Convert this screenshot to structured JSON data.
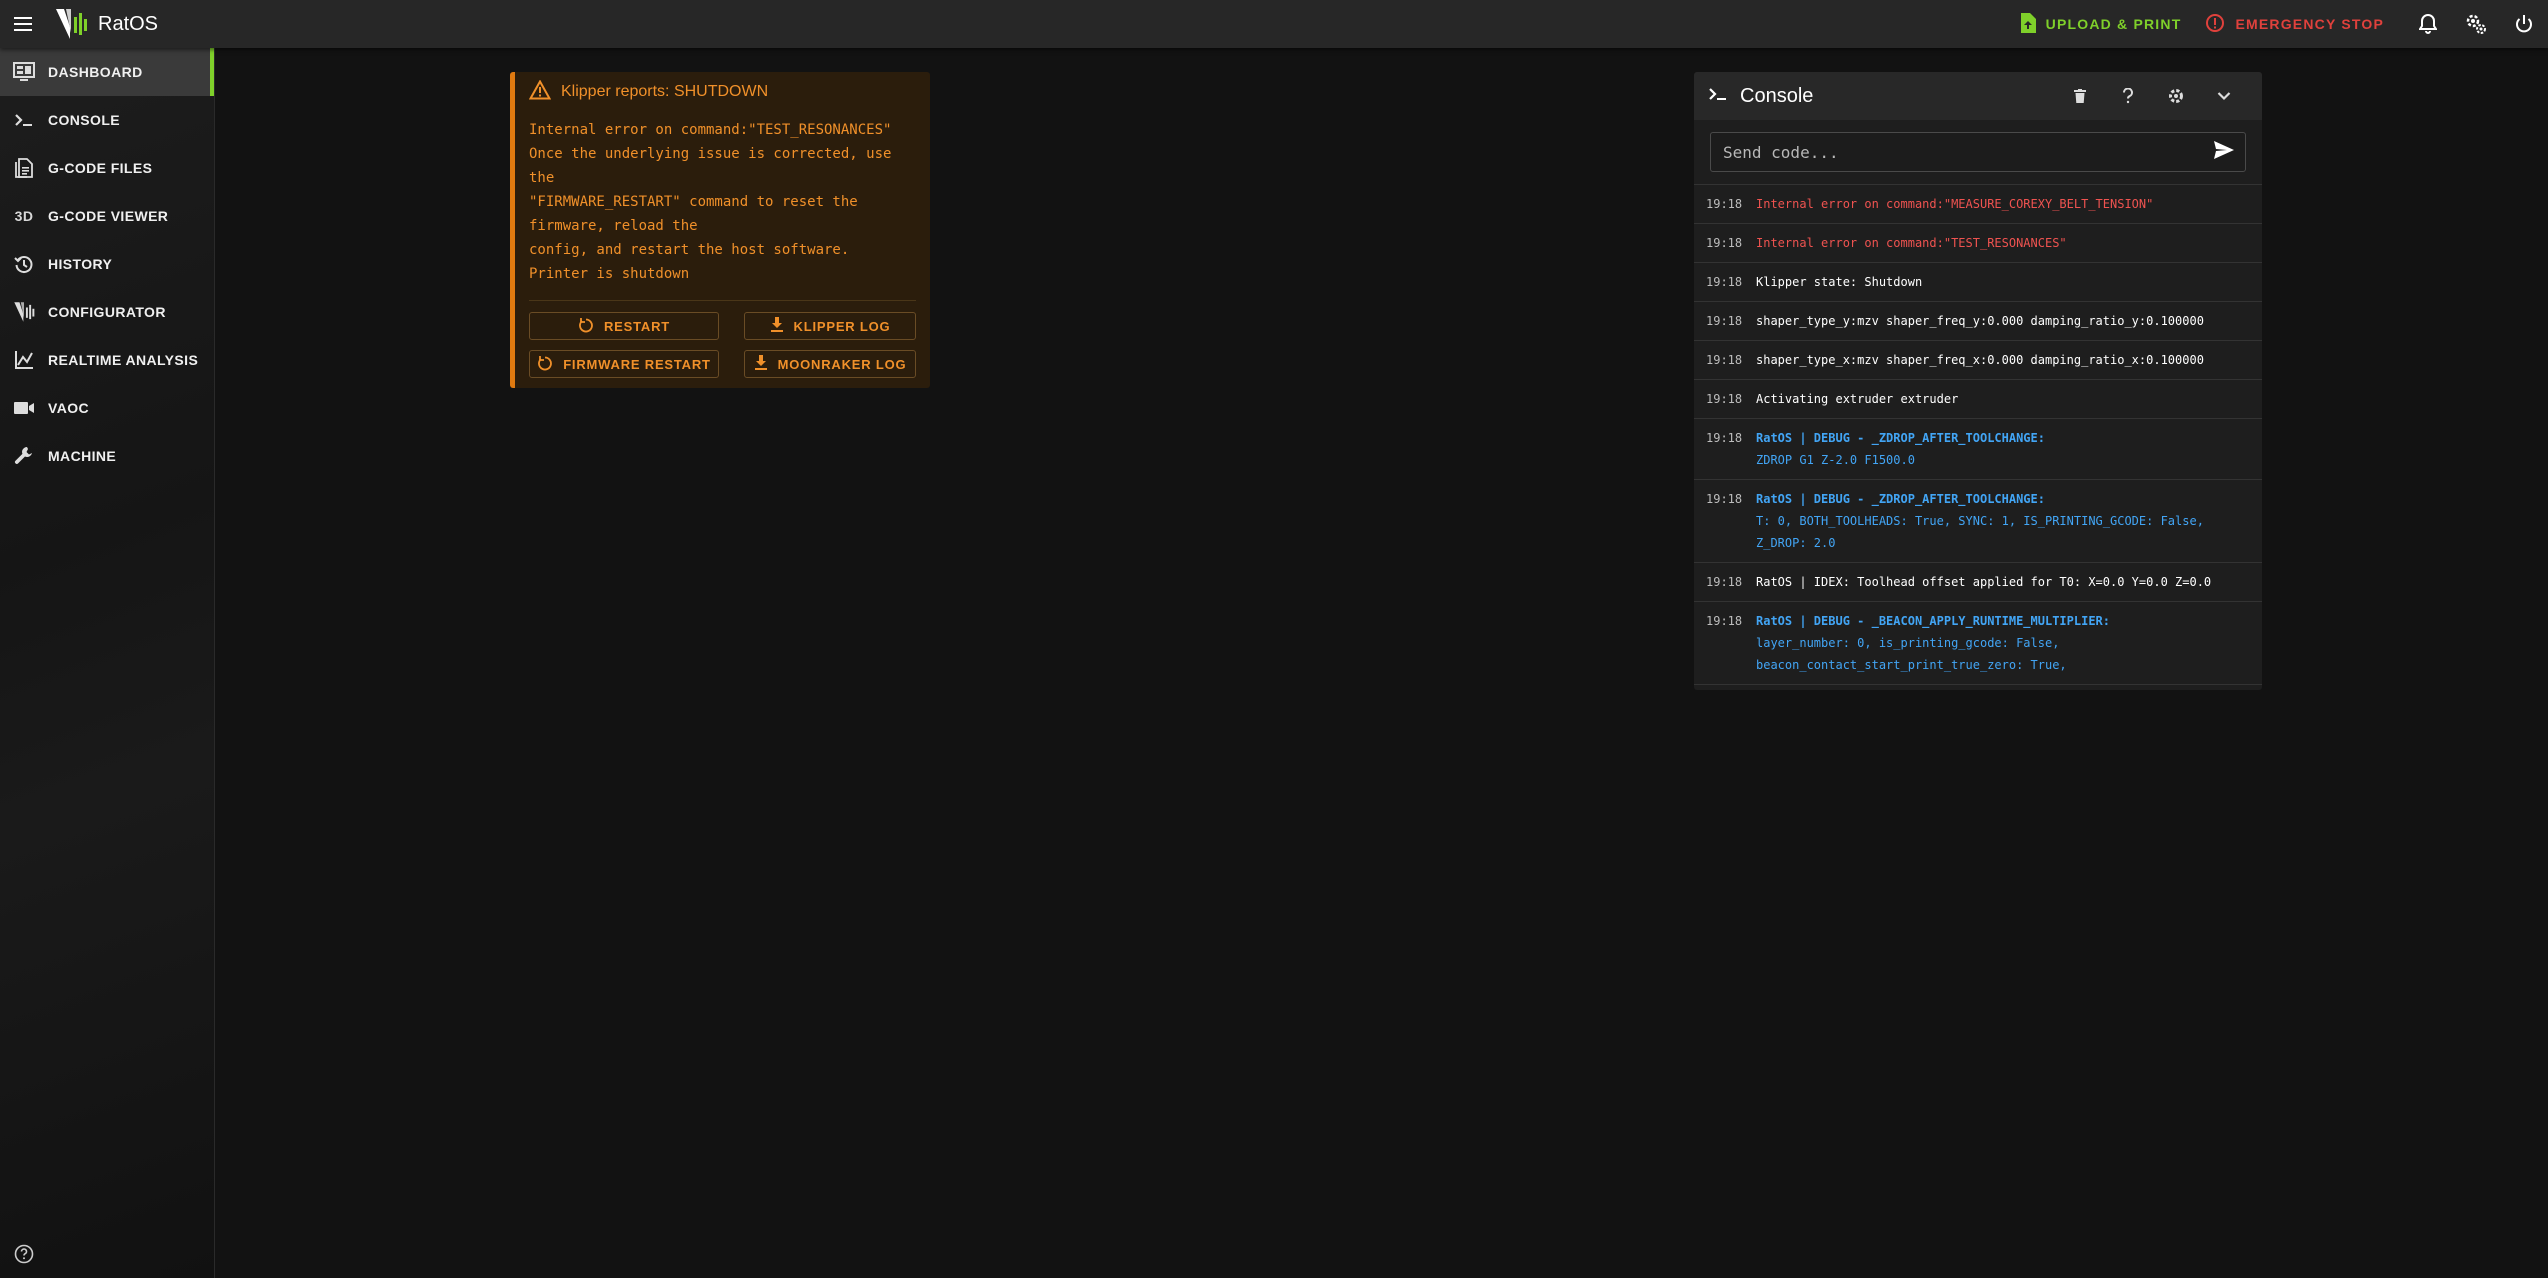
{
  "app": {
    "title": "RatOS",
    "upload_label": "UPLOAD & PRINT",
    "estop_label": "EMERGENCY STOP",
    "colors": {
      "accent": "#7fd02a",
      "danger": "#e0413c",
      "warning": "#f0902a"
    }
  },
  "sidebar": {
    "items": [
      {
        "label": "DASHBOARD",
        "icon": "monitor-dashboard-icon"
      },
      {
        "label": "CONSOLE",
        "icon": "console-prompt-icon"
      },
      {
        "label": "G-CODE FILES",
        "icon": "file-document-icon"
      },
      {
        "label": "G-CODE VIEWER",
        "icon": "3d-icon",
        "glyph": "3D"
      },
      {
        "label": "HISTORY",
        "icon": "history-icon"
      },
      {
        "label": "CONFIGURATOR",
        "icon": "ratos-logo-icon"
      },
      {
        "label": "REALTIME ANALYSIS",
        "icon": "chart-line-icon"
      },
      {
        "label": "VAOC",
        "icon": "video-camera-icon"
      },
      {
        "label": "MACHINE",
        "icon": "wrench-icon"
      }
    ]
  },
  "shutdown": {
    "title": "Klipper reports: SHUTDOWN",
    "message": "Internal error on command:\"TEST_RESONANCES\"\nOnce the underlying issue is corrected, use\nthe\n\"FIRMWARE_RESTART\" command to reset the\nfirmware, reload the\nconfig, and restart the host software.\nPrinter is shutdown",
    "buttons": {
      "restart": "RESTART",
      "klipper_log": "KLIPPER LOG",
      "firmware_restart": "FIRMWARE RESTART",
      "moonraker_log": "MOONRAKER LOG"
    }
  },
  "console": {
    "title": "Console",
    "placeholder": "Send code...",
    "entries": [
      {
        "time": "19:18",
        "type": "error",
        "text": "Internal error on command:\"MEASURE_COREXY_BELT_TENSION\""
      },
      {
        "time": "19:18",
        "type": "error",
        "text": "Internal error on command:\"TEST_RESONANCES\""
      },
      {
        "time": "19:18",
        "type": "normal",
        "text": "Klipper state: Shutdown"
      },
      {
        "time": "19:18",
        "type": "normal",
        "text": "shaper_type_y:mzv shaper_freq_y:0.000 damping_ratio_y:0.100000"
      },
      {
        "time": "19:18",
        "type": "normal",
        "text": "shaper_type_x:mzv shaper_freq_x:0.000 damping_ratio_x:0.100000"
      },
      {
        "time": "19:18",
        "type": "normal",
        "text": "Activating extruder extruder"
      },
      {
        "time": "19:18",
        "type": "info",
        "head": "RatOS | DEBUG - _ZDROP_AFTER_TOOLCHANGE:",
        "text": "ZDROP G1 Z-2.0 F1500.0"
      },
      {
        "time": "19:18",
        "type": "info",
        "head": "RatOS | DEBUG - _ZDROP_AFTER_TOOLCHANGE:",
        "text": "T: 0, BOTH_TOOLHEADS: True, SYNC: 1, IS_PRINTING_GCODE: False,\nZ_DROP: 2.0"
      },
      {
        "time": "19:18",
        "type": "normal",
        "text": "RatOS | IDEX: Toolhead offset applied for T0: X=0.0 Y=0.0 Z=0.0"
      },
      {
        "time": "19:18",
        "type": "info",
        "head": "RatOS | DEBUG - _BEACON_APPLY_RUNTIME_MULTIPLIER:",
        "text": "layer_number: 0, is_printing_gcode: False,\nbeacon_contact_start_print_true_zero: True,"
      }
    ]
  }
}
